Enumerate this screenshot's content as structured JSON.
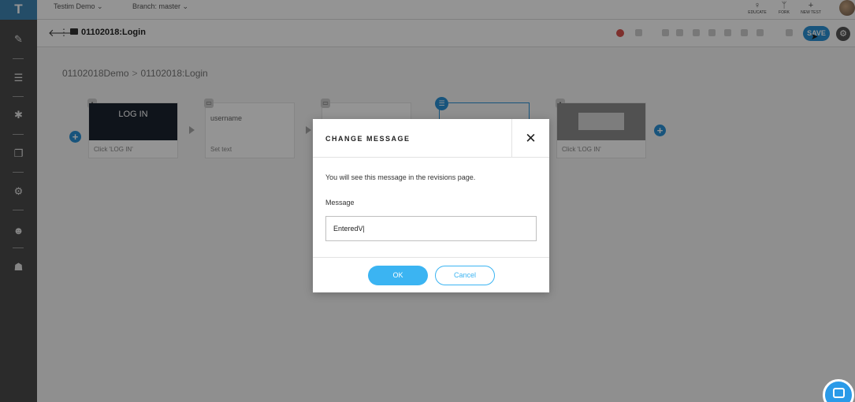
{
  "sidebar": {
    "logo": "T"
  },
  "topbar": {
    "project": "Testim Demo ⌄",
    "branch": "Branch: master ⌄",
    "actions": [
      {
        "label": "EDUCATE",
        "icon": "lightbulb-icon",
        "glyph": "♀"
      },
      {
        "label": "FORK",
        "icon": "fork-icon",
        "glyph": "ᛘ"
      },
      {
        "label": "NEW TEST",
        "icon": "plus-icon",
        "glyph": "+"
      }
    ]
  },
  "toolbar": {
    "test_name": "01102018:Login",
    "save_label": "SAVE",
    "settings_glyph": "⚙"
  },
  "breadcrumb": {
    "project": "01102018Demo",
    "separator": ">",
    "test": "01102018:Login"
  },
  "steps": [
    {
      "thumb": "LOG IN",
      "caption": "Click 'LOG IN'"
    },
    {
      "thumb": "username",
      "caption": "Set text"
    },
    {
      "thumb": "",
      "caption": ""
    },
    {
      "thumb": "",
      "caption": ""
    },
    {
      "thumb": "",
      "caption": "Click 'LOG IN'"
    }
  ],
  "modal": {
    "title": "CHANGE MESSAGE",
    "close": "✕",
    "description": "You will see this message in the revisions page.",
    "field_label": "Message",
    "message_value": "EnteredV|",
    "ok_label": "OK",
    "cancel_label": "Cancel"
  }
}
